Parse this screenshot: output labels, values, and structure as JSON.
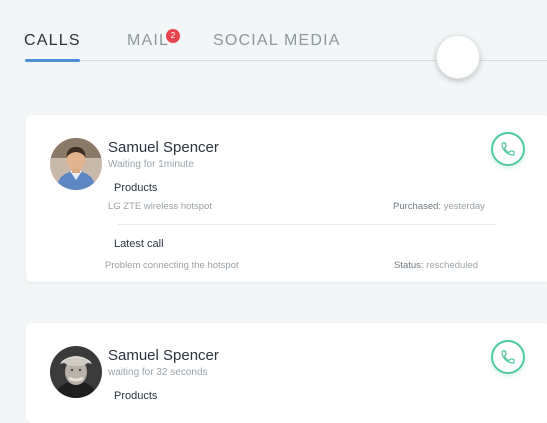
{
  "tabs": {
    "calls": "CALLS",
    "mail": "MAIL",
    "mail_badge": "2",
    "social": "SOCIAL MEDIA"
  },
  "colors": {
    "accent": "#4a90d9",
    "call_green": "#4fc99a",
    "badge_red": "#e8434e"
  },
  "cards": [
    {
      "name": "Samuel Spencer",
      "wait": "Waiting for 1minute",
      "products_title": "Products",
      "product_desc": "LG ZTE wireless hotspot",
      "purchased_label": "Purchased:",
      "purchased_value": "yesterday",
      "latest_title": "Latest call",
      "latest_desc": "Problem connecting the hotspot",
      "status_label": "Status:",
      "status_value": "rescheduled",
      "icon": "phone-icon"
    },
    {
      "name": "Samuel Spencer",
      "wait": "waiting for 32 seconds",
      "products_title": "Products",
      "icon": "phone-icon"
    }
  ]
}
